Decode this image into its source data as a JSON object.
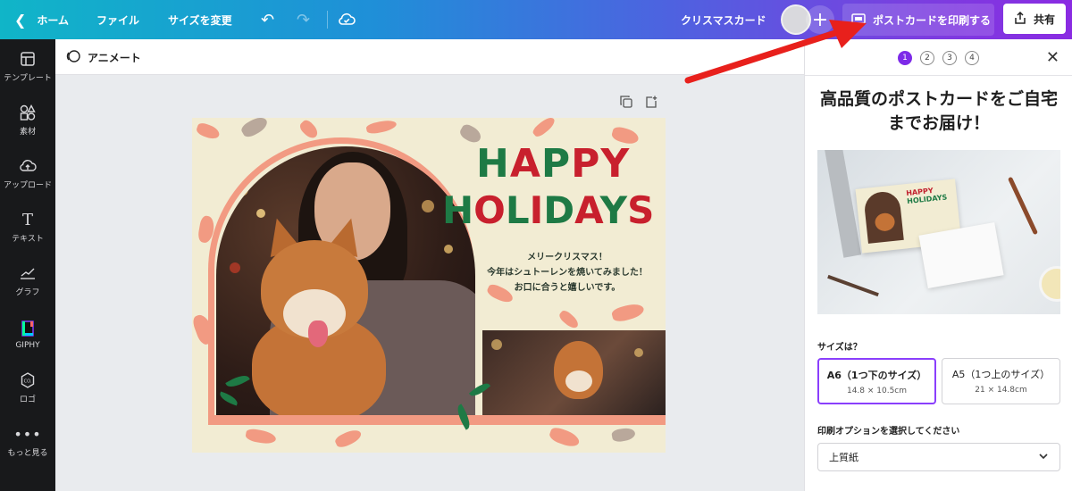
{
  "topbar": {
    "home_label": "ホーム",
    "file_label": "ファイル",
    "resize_label": "サイズを変更",
    "design_title": "クリスマスカード",
    "print_label": "ポストカードを印刷する",
    "share_label": "共有"
  },
  "sidebar": {
    "items": [
      {
        "label": "テンプレート",
        "icon": "template-icon"
      },
      {
        "label": "素材",
        "icon": "elements-icon"
      },
      {
        "label": "アップロード",
        "icon": "upload-icon"
      },
      {
        "label": "テキスト",
        "icon": "text-icon"
      },
      {
        "label": "グラフ",
        "icon": "chart-icon"
      },
      {
        "label": "GIPHY",
        "icon": "giphy-icon"
      },
      {
        "label": "ロゴ",
        "icon": "logo-icon"
      },
      {
        "label": "もっと見る",
        "icon": "more-icon"
      }
    ]
  },
  "subbar": {
    "animate_label": "アニメート"
  },
  "design": {
    "line1": "HAPPY",
    "line2": "HOLIDAYS",
    "message": [
      "メリークリスマス！",
      "今年はシュトーレンを焼いてみました！",
      "お口に合うと嬉しいです。"
    ],
    "colors": {
      "red": "#c8202d",
      "green": "#1e7a45",
      "cream": "#f2ecd3",
      "salmon": "#f29a82"
    }
  },
  "panel": {
    "steps": [
      "1",
      "2",
      "3",
      "4"
    ],
    "active_step": 1,
    "headline": "高品質のポストカードをご自宅までお届け！",
    "size_question": "サイズは？",
    "sizes": [
      {
        "name": "A6（1つ下のサイズ）",
        "dim": "14.8 × 10.5cm",
        "selected": true
      },
      {
        "name": "A5（1つ上のサイズ）",
        "dim": "21 × 14.8cm",
        "selected": false
      }
    ],
    "print_option_label": "印刷オプションを選択してください",
    "print_option_value": "上質紙"
  },
  "colors": {
    "accent": "#7d2ae8",
    "annotation_arrow": "#e8201c"
  }
}
